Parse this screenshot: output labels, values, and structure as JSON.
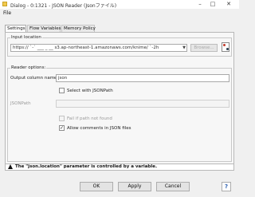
{
  "window": {
    "title": "Dialog - 0:1321 - JSON Reader (Jsonファイル)",
    "controls": {
      "minimize": "–",
      "maximize": "□",
      "close": "✕"
    }
  },
  "menu": {
    "file": "File"
  },
  "tabs": [
    {
      "label": "Settings",
      "active": true
    },
    {
      "label": "Flow Variables",
      "active": false
    },
    {
      "label": "Memory Policy",
      "active": false
    }
  ],
  "input_location": {
    "group_label": "Input location",
    "url": "https://  `-` ___  _  __ s3.ap-northeast-1.amazonaws.com/knime/  `-2h",
    "browse_label": "Browse..."
  },
  "reader_options": {
    "group_label": "Reader options:",
    "output_column_label": "Output column name",
    "output_column_value": "json",
    "select_with_jsonpath_label": "Select with JSONPath",
    "select_with_jsonpath_checked": false,
    "jsonpath_label": "JSONPath",
    "jsonpath_value": "",
    "fail_if_not_found_label": "Fail if path not found",
    "fail_if_not_found_checked": false,
    "allow_comments_label": "Allow comments in JSON files",
    "allow_comments_checked": true
  },
  "warning": {
    "text": "The \"json.location\" parameter is controlled by a variable."
  },
  "buttons": {
    "ok": "OK",
    "apply": "Apply",
    "cancel": "Cancel",
    "help": "?"
  },
  "colors": {
    "warning_icon": "#111111",
    "help_icon": "#2a5db0"
  }
}
